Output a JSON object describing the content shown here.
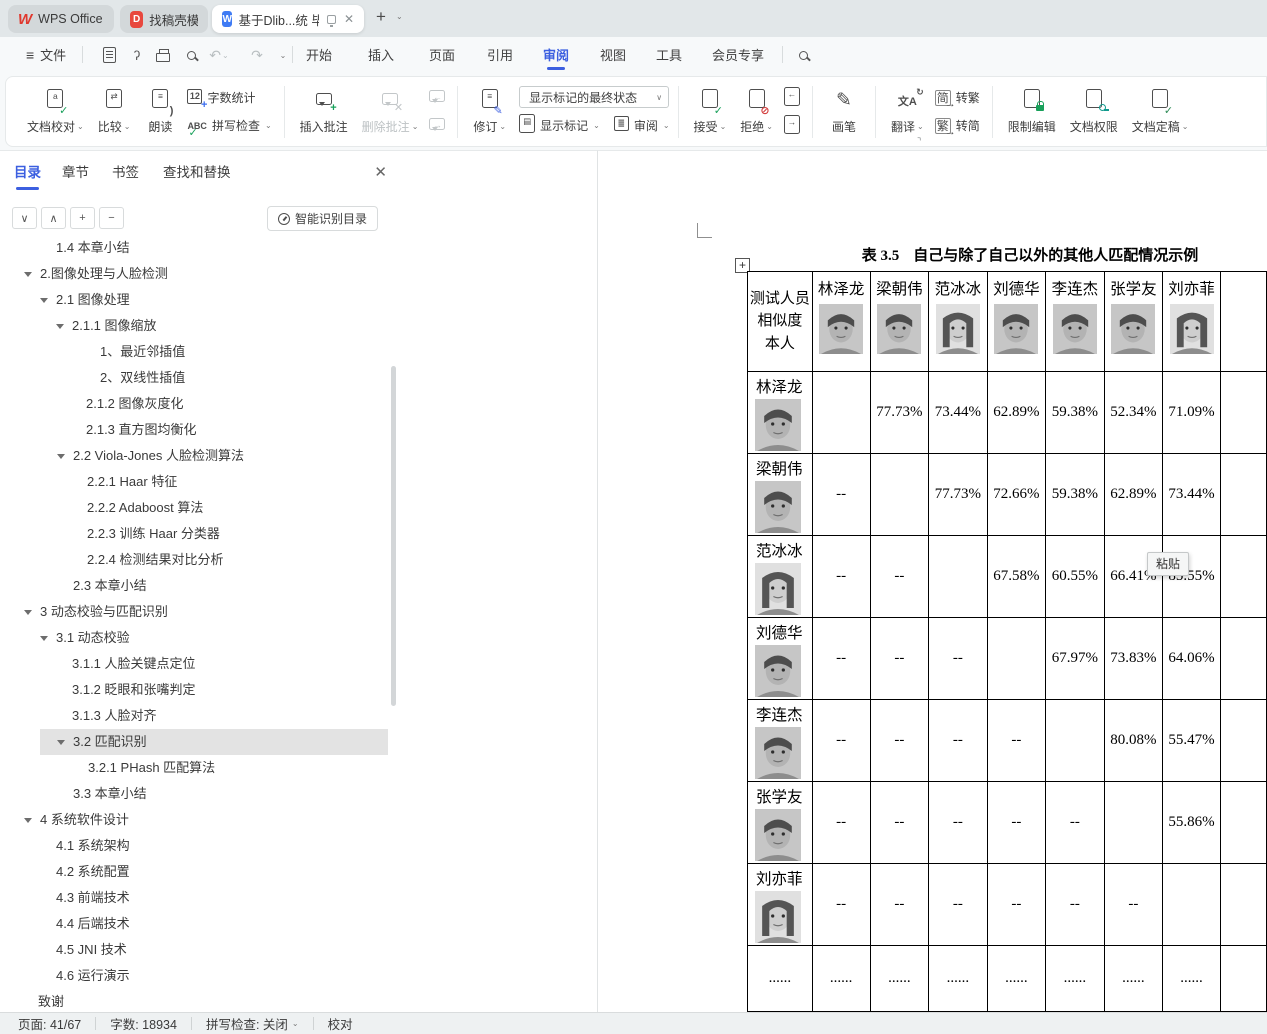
{
  "window": {
    "tabs": [
      {
        "id": "wps",
        "label": "WPS Office",
        "icon": "wps-logo"
      },
      {
        "id": "docer",
        "label": "找稿壳模板",
        "icon": "docer-logo"
      },
      {
        "id": "doc",
        "label": "基于Dlib...统 毕业论文",
        "icon": "document-w-logo",
        "active": true
      }
    ],
    "new_tab_label": "+"
  },
  "menubar": {
    "file": "文件",
    "quick_icons": [
      "save-icon",
      "export-icon",
      "print-icon",
      "print-preview-icon",
      "undo-icon",
      "redo-icon"
    ],
    "menus": [
      "开始",
      "插入",
      "页面",
      "引用",
      "审阅",
      "视图",
      "工具",
      "会员专享"
    ],
    "active_menu": "审阅"
  },
  "ribbon": {
    "groups": [
      {
        "buttons": [
          {
            "type": "big",
            "label": "文档校对",
            "icon": "doc-proof-icon",
            "dropdown": true
          },
          {
            "type": "big",
            "label": "比较",
            "icon": "compare-icon",
            "dropdown": true
          },
          {
            "type": "big",
            "label": "朗读",
            "icon": "read-aloud-icon"
          },
          {
            "type": "stack",
            "items": [
              {
                "label": "字数统计",
                "icon": "word-count-icon"
              },
              {
                "label": "拼写检查",
                "icon": "spell-check-icon",
                "dropdown": true
              }
            ]
          }
        ]
      },
      {
        "buttons": [
          {
            "type": "big",
            "label": "插入批注",
            "icon": "insert-comment-icon"
          },
          {
            "type": "big",
            "label": "删除批注",
            "icon": "delete-comment-icon",
            "dropdown": true,
            "disabled": true
          },
          {
            "type": "stack",
            "items": [
              {
                "icon": "previous-comment-icon",
                "disabled": true
              },
              {
                "icon": "next-comment-icon",
                "disabled": true
              }
            ]
          }
        ]
      },
      {
        "buttons": [
          {
            "type": "big",
            "label": "修订",
            "icon": "track-changes-icon",
            "dropdown": true
          },
          {
            "type": "markup-col",
            "combo": "显示标记的最终状态",
            "row": [
              {
                "label": "显示标记",
                "icon": "show-markup-icon",
                "dropdown": true
              },
              {
                "label": "审阅",
                "icon": "review-pane-icon",
                "dropdown": true
              }
            ]
          }
        ]
      },
      {
        "buttons": [
          {
            "type": "big",
            "label": "接受",
            "icon": "accept-icon",
            "dropdown": true
          },
          {
            "type": "big",
            "label": "拒绝",
            "icon": "reject-icon",
            "dropdown": true
          },
          {
            "type": "stack",
            "items": [
              {
                "icon": "goto-previous-icon"
              },
              {
                "icon": "goto-next-icon"
              }
            ]
          }
        ]
      },
      {
        "buttons": [
          {
            "type": "big",
            "label": "画笔",
            "icon": "brush-icon"
          }
        ]
      },
      {
        "buttons": [
          {
            "type": "big",
            "label": "翻译",
            "icon": "translate-icon",
            "dropdown": true
          },
          {
            "type": "stack",
            "items": [
              {
                "label": "转繁",
                "icon": "simplified-to-traditional-icon"
              },
              {
                "label": "转简",
                "icon": "traditional-to-simplified-icon"
              }
            ]
          }
        ]
      },
      {
        "buttons": [
          {
            "type": "big",
            "label": "限制编辑",
            "icon": "restrict-edit-icon"
          },
          {
            "type": "big",
            "label": "文档权限",
            "icon": "doc-permission-icon"
          },
          {
            "type": "big",
            "label": "文档定稿",
            "icon": "doc-finalize-icon",
            "dropdown": true
          }
        ]
      }
    ]
  },
  "sidebar": {
    "tabs": [
      {
        "label": "目录",
        "active": true
      },
      {
        "label": "章节"
      },
      {
        "label": "书签"
      },
      {
        "label": "查找和替换"
      }
    ],
    "tools": [
      {
        "name": "expand-down-button",
        "glyph": "∨"
      },
      {
        "name": "collapse-up-button",
        "glyph": "∧"
      },
      {
        "name": "zoom-in-button",
        "glyph": "+"
      },
      {
        "name": "zoom-out-button",
        "glyph": "−"
      }
    ],
    "smart_toc_label": "智能识别目录",
    "toc": [
      {
        "label": "1.4 本章小结",
        "indent": 56
      },
      {
        "label": "2.图像处理与人脸检测",
        "indent": 40,
        "arrow": true
      },
      {
        "label": "2.1 图像处理",
        "indent": 56,
        "arrow": true
      },
      {
        "label": "2.1.1 图像缩放",
        "indent": 72,
        "arrow": true
      },
      {
        "label": "1、最近邻插值",
        "indent": 100
      },
      {
        "label": "2、双线性插值",
        "indent": 100
      },
      {
        "label": "2.1.2 图像灰度化",
        "indent": 86
      },
      {
        "label": "2.1.3 直方图均衡化",
        "indent": 86
      },
      {
        "label": "2.2 Viola-Jones 人脸检测算法",
        "indent": 73,
        "arrow": true
      },
      {
        "label": "2.2.1 Haar 特征",
        "indent": 87
      },
      {
        "label": "2.2.2 Adaboost 算法",
        "indent": 87
      },
      {
        "label": "2.2.3 训练 Haar 分类器",
        "indent": 87
      },
      {
        "label": "2.2.4 检测结果对比分析",
        "indent": 87
      },
      {
        "label": "2.3 本章小结",
        "indent": 73
      },
      {
        "label": "3 动态校验与匹配识别",
        "indent": 40,
        "arrow": true
      },
      {
        "label": "3.1 动态校验",
        "indent": 56,
        "arrow": true
      },
      {
        "label": "3.1.1 人脸关键点定位",
        "indent": 72
      },
      {
        "label": "3.1.2 眨眼和张嘴判定",
        "indent": 72
      },
      {
        "label": "3.1.3 人脸对齐",
        "indent": 72
      },
      {
        "label": "3.2 匹配识别",
        "indent": 73,
        "arrow": true,
        "selected": true
      },
      {
        "label": "3.2.1 PHash 匹配算法",
        "indent": 88
      },
      {
        "label": "3.3 本章小结",
        "indent": 73
      },
      {
        "label": "4 系统软件设计",
        "indent": 40,
        "arrow": true
      },
      {
        "label": "4.1 系统架构",
        "indent": 56
      },
      {
        "label": "4.2 系统配置",
        "indent": 56
      },
      {
        "label": "4.3 前端技术",
        "indent": 56
      },
      {
        "label": "4.4 后端技术",
        "indent": 56
      },
      {
        "label": "4.5 JNI 技术",
        "indent": 56
      },
      {
        "label": "4.6 运行演示",
        "indent": 56
      },
      {
        "label": "致谢",
        "indent": 38
      }
    ]
  },
  "document": {
    "caption": {
      "prefix": "表 3.5",
      "text": "自己与除了自己以外的其他人匹配情况示例"
    },
    "paste_tooltip": "粘贴",
    "table": {
      "corner_header": [
        "测试人员",
        "相似度",
        "本人"
      ],
      "columns": [
        {
          "name": "林泽龙",
          "portrait": "male"
        },
        {
          "name": "梁朝伟",
          "portrait": "male"
        },
        {
          "name": "范冰冰",
          "portrait": "female"
        },
        {
          "name": "刘德华",
          "portrait": "male"
        },
        {
          "name": "李连杰",
          "portrait": "male"
        },
        {
          "name": "张学友",
          "portrait": "male"
        },
        {
          "name": "刘亦菲",
          "portrait": "female"
        }
      ],
      "rows": [
        {
          "name": "林泽龙",
          "portrait": "male",
          "cells": [
            "",
            "77.73%",
            "73.44%",
            "62.89%",
            "59.38%",
            "52.34%",
            "71.09%"
          ]
        },
        {
          "name": "梁朝伟",
          "portrait": "male",
          "cells": [
            "--",
            "",
            "77.73%",
            "72.66%",
            "59.38%",
            "62.89%",
            "73.44%"
          ]
        },
        {
          "name": "范冰冰",
          "portrait": "female",
          "cells": [
            "--",
            "--",
            "",
            "67.58%",
            "60.55%",
            "66.41%",
            "85.55%"
          ]
        },
        {
          "name": "刘德华",
          "portrait": "male",
          "cells": [
            "--",
            "--",
            "--",
            "",
            "67.97%",
            "73.83%",
            "64.06%"
          ]
        },
        {
          "name": "李连杰",
          "portrait": "male",
          "cells": [
            "--",
            "--",
            "--",
            "--",
            "",
            "80.08%",
            "55.47%"
          ]
        },
        {
          "name": "张学友",
          "portrait": "male",
          "cells": [
            "--",
            "--",
            "--",
            "--",
            "--",
            "",
            "55.86%"
          ]
        },
        {
          "name": "刘亦菲",
          "portrait": "female",
          "cells": [
            "--",
            "--",
            "--",
            "--",
            "--",
            "--",
            ""
          ]
        },
        {
          "name": "......",
          "ellipsis": true,
          "cells": [
            "......",
            "......",
            "......",
            "......",
            "......",
            "......",
            "......"
          ]
        }
      ]
    }
  },
  "statusbar": {
    "page": "页面: 41/67",
    "words": "字数: 18934",
    "spell": "拼写检查: 关闭",
    "proof": "校对"
  }
}
